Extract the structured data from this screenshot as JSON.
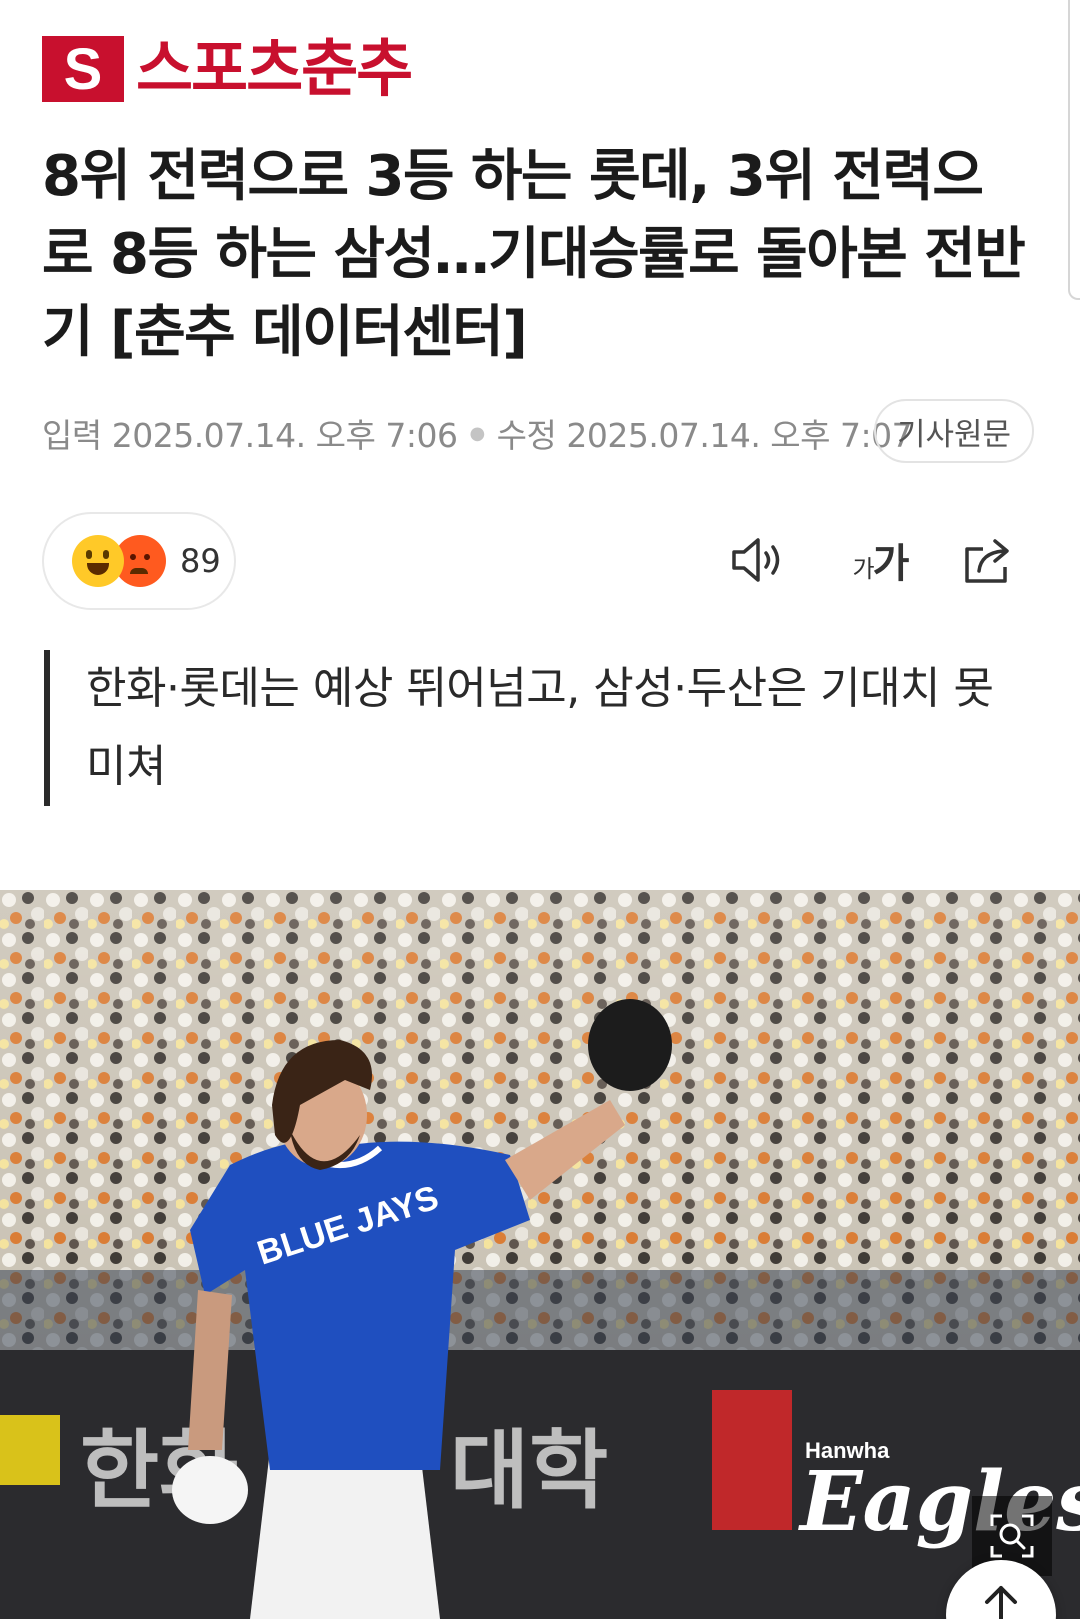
{
  "logo": {
    "mark": "S",
    "name": "스포츠춘추"
  },
  "article": {
    "headline": "8위 전력으로 3등 하는 롯데, 3위 전력으로 8등 하는 삼성…기대승률로 돌아본 전반기 [춘추 데이터센터]",
    "published": "입력 2025.07.14. 오후 7:06",
    "modified": "수정 2025.07.14. 오후 7:07",
    "original_label": "기사원문",
    "subhead": "한화·롯데는 예상 뛰어넘고, 삼성·두산은 기대치 못 미쳐"
  },
  "reactions": {
    "count": "89",
    "icons": [
      "smile-emoji",
      "angry-emoji"
    ]
  },
  "toolbar": {
    "icons": [
      "speaker-icon",
      "font-size-icon",
      "share-icon"
    ],
    "font_small": "가",
    "font_large": "가"
  },
  "photo": {
    "jersey_text": "BLUE JAYS",
    "banner_text_left": "한화 대학",
    "banner_brand": "Hanwha",
    "banner_script": "Eagles"
  },
  "colors": {
    "brand_red": "#c8102e",
    "jersey_blue": "#1f4fbf",
    "meta_gray": "#8a8a8a"
  }
}
